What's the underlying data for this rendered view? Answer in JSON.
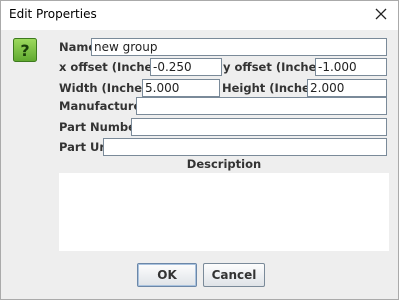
{
  "window": {
    "title": "Edit Properties",
    "close_icon": "close-x-icon",
    "help_icon": "question-mark-icon",
    "help_glyph": "?"
  },
  "form": {
    "name_label": "Name",
    "name_value": "new group",
    "x_offset_label": "x offset (Inches)",
    "x_offset_value": "-0.250",
    "y_offset_label": "y offset (Inches)",
    "y_offset_value": "-1.000",
    "width_label": "Width (Inches)",
    "width_value": "5.000",
    "height_label": "Height (Inches)",
    "height_value": "2.000",
    "manufacturer_label": "Manufacturer",
    "manufacturer_value": "",
    "part_number_label": "Part Number",
    "part_number_value": "",
    "part_url_label": "Part Url",
    "part_url_value": "",
    "description_label": "Description",
    "description_value": ""
  },
  "buttons": {
    "ok_label": "OK",
    "cancel_label": "Cancel"
  },
  "colors": {
    "help_icon_fill": "#7cc142",
    "help_icon_border": "#3d7a1e"
  }
}
